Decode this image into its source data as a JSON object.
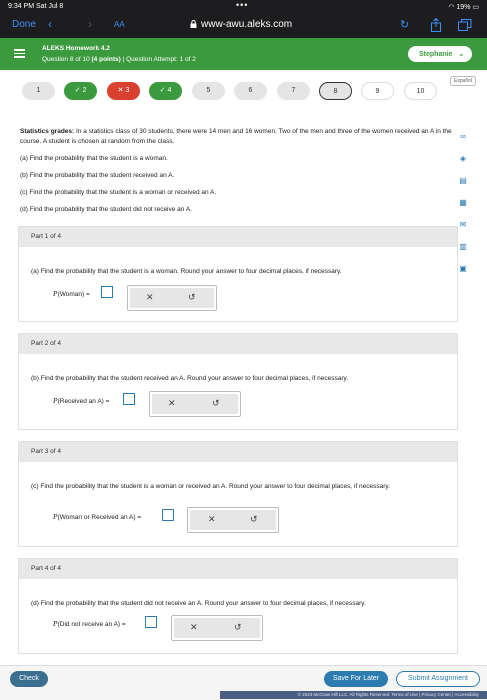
{
  "status_bar": {
    "time": "9:34 PM  Sat Jul 8",
    "dots": "•••",
    "battery": "19%"
  },
  "browser": {
    "done_label": "Done",
    "text_size_label": "AA",
    "url": "www-awu.aleks.com"
  },
  "header": {
    "title": "ALEKS Homework 4.2",
    "subtitle_prefix": "Question 8 of 10 ",
    "subtitle_points": "(4 points)",
    "subtitle_sep": "  |  ",
    "subtitle_attempt": "Question Attempt: 1 of 2",
    "user_name": "Stephanie",
    "accent_color": "#3c9a3e"
  },
  "espanol_label": "Español",
  "question_nav": [
    {
      "label": "1",
      "state": "default"
    },
    {
      "label": "✓ 2",
      "state": "correct"
    },
    {
      "label": "✕ 3",
      "state": "wrong"
    },
    {
      "label": "✓ 4",
      "state": "correct"
    },
    {
      "label": "5",
      "state": "default"
    },
    {
      "label": "6",
      "state": "default"
    },
    {
      "label": "7",
      "state": "default"
    },
    {
      "label": "8",
      "state": "current"
    },
    {
      "label": "9",
      "state": "white"
    },
    {
      "label": "10",
      "state": "white"
    }
  ],
  "problem": {
    "heading": "Statistics grades:",
    "text": " In a statistics class of 30 students, there were 14 men and 16 women. Two of the men and three of the women received an A in the course. A student is chosen at random from the class.",
    "items": [
      "(a) Find the probability that the student is a woman.",
      "(b) Find the probability that the student received an A.",
      "(c) Find the probability that the student is a woman or received an A.",
      "(d) Find the probability that the student did not receive an A."
    ]
  },
  "parts": [
    {
      "header": "Part 1 of 4",
      "question": "(a) Find the probability that the student is a woman. Round your answer to four decimal places, if necessary.",
      "label_p": "P",
      "label_rest": "(Woman) ="
    },
    {
      "header": "Part 2 of 4",
      "question": "(b) Find the probability that the student received an A. Round your answer to four decimal places, if necessary.",
      "label_p": "P",
      "label_rest": "(Received an A) ="
    },
    {
      "header": "Part 3 of 4",
      "question": "(c) Find the probability that the student is a woman or received an A. Round your answer to four decimal places, if necessary.",
      "label_p": "P",
      "label_rest": "(Woman or Received an A) ="
    },
    {
      "header": "Part 4 of 4",
      "question": "(d) Find the probability that the student did not receive an A. Round your answer to four decimal places, if necessary.",
      "label_p": "P",
      "label_rest": "(Did not receive an A) ="
    }
  ],
  "action_icons": {
    "clear": "✕",
    "undo": "↺"
  },
  "footer": {
    "check_label": "Check",
    "save_label": "Save For Later",
    "submit_label": "Submit Assignment",
    "copyright": "© 2023 McGraw Hill LLC. All Rights Reserved.   Terms of Use  |  Privacy Center  |  Accessibility"
  }
}
